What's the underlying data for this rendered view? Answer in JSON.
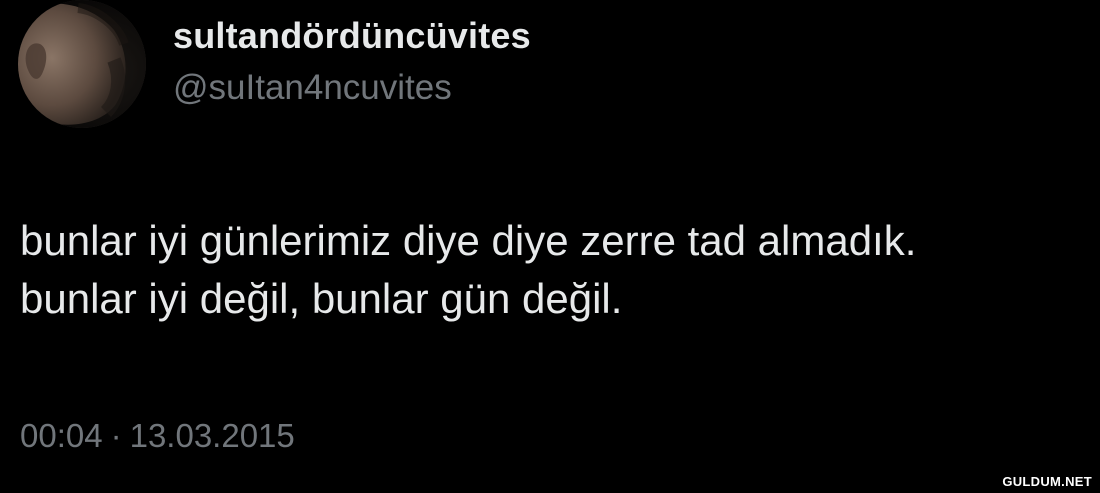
{
  "tweet": {
    "author": {
      "display_name": "sultandördüncüvites",
      "handle": "@suItan4ncuvites"
    },
    "text_lines": [
      "bunlar iyi günlerimiz diye diye zerre tad almadık.",
      "bunlar iyi değil, bunlar gün değil."
    ],
    "time": "00:04",
    "separator": "·",
    "date": "13.03.2015"
  },
  "watermark": "GULDUM.NET",
  "colors": {
    "background": "#000000",
    "primary_text": "#e7e9ea",
    "secondary_text": "#71767b"
  }
}
